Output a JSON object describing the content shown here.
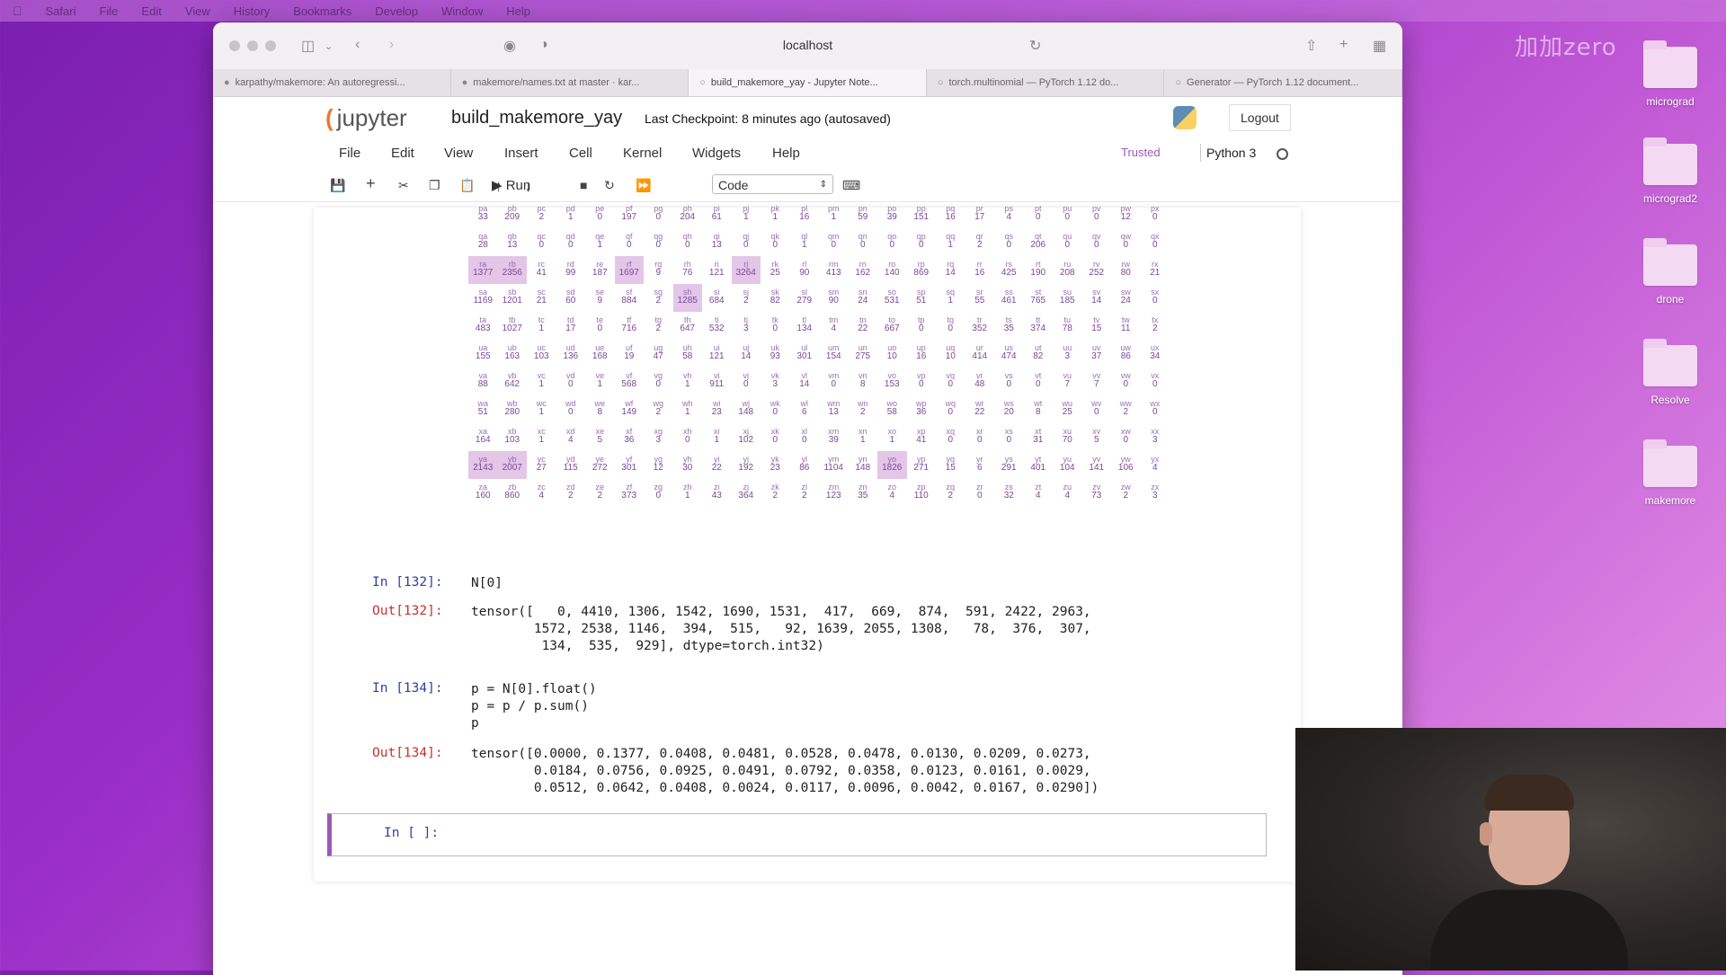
{
  "menubar": {
    "items": [
      "Safari",
      "File",
      "Edit",
      "View",
      "History",
      "Bookmarks",
      "Develop",
      "Window",
      "Help"
    ]
  },
  "watermark": "加加zero",
  "desktop": {
    "icons": [
      "micrograd",
      "micrograd2",
      "drone",
      "Resolve",
      "makemore"
    ]
  },
  "browser": {
    "url": "localhost",
    "tabs": [
      "karpathy/makemore: An autoregressi...",
      "makemore/names.txt at master · kar...",
      "build_makemore_yay - Jupyter Note...",
      "torch.multinomial — PyTorch 1.12 do...",
      "Generator — PyTorch 1.12 document..."
    ]
  },
  "jupyter": {
    "logo": "jupyter",
    "notebook_name": "build_makemore_yay",
    "checkpoint": "Last Checkpoint: 8 minutes ago  (autosaved)",
    "logout": "Logout",
    "menu": [
      "File",
      "Edit",
      "View",
      "Insert",
      "Cell",
      "Kernel",
      "Widgets",
      "Help"
    ],
    "trusted": "Trusted",
    "kernel": "Python 3",
    "toolbar": {
      "run_label": "Run",
      "cell_type": "Code"
    }
  },
  "bigram_grid": {
    "rows": [
      [
        [
          "pa",
          "33"
        ],
        [
          "pb",
          "209"
        ],
        [
          "pc",
          "2"
        ],
        [
          "pd",
          "1"
        ],
        [
          "pe",
          "0"
        ],
        [
          "pf",
          "197"
        ],
        [
          "pg",
          "0"
        ],
        [
          "ph",
          "204"
        ],
        [
          "pi",
          "61"
        ],
        [
          "pj",
          "1"
        ],
        [
          "pk",
          "1"
        ],
        [
          "pl",
          "16"
        ],
        [
          "pm",
          "1"
        ],
        [
          "pn",
          "59"
        ],
        [
          "po",
          "39"
        ],
        [
          "pp",
          "151"
        ],
        [
          "pq",
          "16"
        ],
        [
          "pr",
          "17"
        ],
        [
          "ps",
          "4"
        ],
        [
          "pt",
          "0"
        ],
        [
          "pu",
          "0"
        ],
        [
          "pv",
          "0"
        ],
        [
          "pw",
          "12"
        ],
        [
          "px",
          "0"
        ]
      ],
      [
        [
          "qa",
          "28"
        ],
        [
          "qb",
          "13"
        ],
        [
          "qc",
          "0"
        ],
        [
          "qd",
          "0"
        ],
        [
          "qe",
          "1"
        ],
        [
          "qf",
          "0"
        ],
        [
          "qg",
          "0"
        ],
        [
          "qh",
          "0"
        ],
        [
          "qi",
          "13"
        ],
        [
          "qj",
          "0"
        ],
        [
          "qk",
          "0"
        ],
        [
          "ql",
          "1"
        ],
        [
          "qm",
          "0"
        ],
        [
          "qn",
          "0"
        ],
        [
          "qo",
          "0"
        ],
        [
          "qp",
          "0"
        ],
        [
          "qq",
          "1"
        ],
        [
          "qr",
          "2"
        ],
        [
          "qs",
          "0"
        ],
        [
          "qt",
          "206"
        ],
        [
          "qu",
          "0"
        ],
        [
          "qv",
          "0"
        ],
        [
          "qw",
          "0"
        ],
        [
          "qx",
          "0"
        ]
      ],
      [
        [
          "ra",
          "1377"
        ],
        [
          "rb",
          "2356"
        ],
        [
          "rc",
          "41"
        ],
        [
          "rd",
          "99"
        ],
        [
          "re",
          "187"
        ],
        [
          "rf",
          "1697"
        ],
        [
          "rg",
          "9"
        ],
        [
          "rh",
          "76"
        ],
        [
          "ri",
          "121"
        ],
        [
          "rj",
          "3264"
        ],
        [
          "rk",
          "25"
        ],
        [
          "rl",
          "90"
        ],
        [
          "rm",
          "413"
        ],
        [
          "rn",
          "162"
        ],
        [
          "ro",
          "140"
        ],
        [
          "rp",
          "869"
        ],
        [
          "rq",
          "14"
        ],
        [
          "rr",
          "16"
        ],
        [
          "rs",
          "425"
        ],
        [
          "rt",
          "190"
        ],
        [
          "ru",
          "208"
        ],
        [
          "rv",
          "252"
        ],
        [
          "rw",
          "80"
        ],
        [
          "rx",
          "21"
        ]
      ],
      [
        [
          "sa",
          "1169"
        ],
        [
          "sb",
          "1201"
        ],
        [
          "sc",
          "21"
        ],
        [
          "sd",
          "60"
        ],
        [
          "se",
          "9"
        ],
        [
          "sf",
          "884"
        ],
        [
          "sg",
          "2"
        ],
        [
          "sh",
          "1285"
        ],
        [
          "si",
          "684"
        ],
        [
          "sj",
          "2"
        ],
        [
          "sk",
          "82"
        ],
        [
          "sl",
          "279"
        ],
        [
          "sm",
          "90"
        ],
        [
          "sn",
          "24"
        ],
        [
          "so",
          "531"
        ],
        [
          "sp",
          "51"
        ],
        [
          "sq",
          "1"
        ],
        [
          "sr",
          "55"
        ],
        [
          "ss",
          "461"
        ],
        [
          "st",
          "765"
        ],
        [
          "su",
          "185"
        ],
        [
          "sv",
          "14"
        ],
        [
          "sw",
          "24"
        ],
        [
          "sx",
          "0"
        ]
      ],
      [
        [
          "ta",
          "483"
        ],
        [
          "tb",
          "1027"
        ],
        [
          "tc",
          "1"
        ],
        [
          "td",
          "17"
        ],
        [
          "te",
          "0"
        ],
        [
          "tf",
          "716"
        ],
        [
          "tg",
          "2"
        ],
        [
          "th",
          "647"
        ],
        [
          "ti",
          "532"
        ],
        [
          "tj",
          "3"
        ],
        [
          "tk",
          "0"
        ],
        [
          "tl",
          "134"
        ],
        [
          "tm",
          "4"
        ],
        [
          "tn",
          "22"
        ],
        [
          "to",
          "667"
        ],
        [
          "tp",
          "0"
        ],
        [
          "tq",
          "0"
        ],
        [
          "tr",
          "352"
        ],
        [
          "ts",
          "35"
        ],
        [
          "tt",
          "374"
        ],
        [
          "tu",
          "78"
        ],
        [
          "tv",
          "15"
        ],
        [
          "tw",
          "11"
        ],
        [
          "tx",
          "2"
        ]
      ],
      [
        [
          "ua",
          "155"
        ],
        [
          "ub",
          "163"
        ],
        [
          "uc",
          "103"
        ],
        [
          "ud",
          "136"
        ],
        [
          "ue",
          "168"
        ],
        [
          "uf",
          "19"
        ],
        [
          "ug",
          "47"
        ],
        [
          "uh",
          "58"
        ],
        [
          "ui",
          "121"
        ],
        [
          "uj",
          "14"
        ],
        [
          "uk",
          "93"
        ],
        [
          "ul",
          "301"
        ],
        [
          "um",
          "154"
        ],
        [
          "un",
          "275"
        ],
        [
          "uo",
          "10"
        ],
        [
          "up",
          "16"
        ],
        [
          "uq",
          "10"
        ],
        [
          "ur",
          "414"
        ],
        [
          "us",
          "474"
        ],
        [
          "ut",
          "82"
        ],
        [
          "uu",
          "3"
        ],
        [
          "uv",
          "37"
        ],
        [
          "uw",
          "86"
        ],
        [
          "ux",
          "34"
        ]
      ],
      [
        [
          "va",
          "88"
        ],
        [
          "vb",
          "642"
        ],
        [
          "vc",
          "1"
        ],
        [
          "vd",
          "0"
        ],
        [
          "ve",
          "1"
        ],
        [
          "vf",
          "568"
        ],
        [
          "vg",
          "0"
        ],
        [
          "vh",
          "1"
        ],
        [
          "vi",
          "911"
        ],
        [
          "vj",
          "0"
        ],
        [
          "vk",
          "3"
        ],
        [
          "vl",
          "14"
        ],
        [
          "vm",
          "0"
        ],
        [
          "vn",
          "8"
        ],
        [
          "vo",
          "153"
        ],
        [
          "vp",
          "0"
        ],
        [
          "vq",
          "0"
        ],
        [
          "vr",
          "48"
        ],
        [
          "vs",
          "0"
        ],
        [
          "vt",
          "0"
        ],
        [
          "vu",
          "7"
        ],
        [
          "vv",
          "7"
        ],
        [
          "vw",
          "0"
        ],
        [
          "vx",
          "0"
        ]
      ],
      [
        [
          "wa",
          "51"
        ],
        [
          "wb",
          "280"
        ],
        [
          "wc",
          "1"
        ],
        [
          "wd",
          "0"
        ],
        [
          "we",
          "8"
        ],
        [
          "wf",
          "149"
        ],
        [
          "wg",
          "2"
        ],
        [
          "wh",
          "1"
        ],
        [
          "wi",
          "23"
        ],
        [
          "wj",
          "148"
        ],
        [
          "wk",
          "0"
        ],
        [
          "wl",
          "6"
        ],
        [
          "wm",
          "13"
        ],
        [
          "wn",
          "2"
        ],
        [
          "wo",
          "58"
        ],
        [
          "wp",
          "36"
        ],
        [
          "wq",
          "0"
        ],
        [
          "wr",
          "22"
        ],
        [
          "ws",
          "20"
        ],
        [
          "wt",
          "8"
        ],
        [
          "wu",
          "25"
        ],
        [
          "wv",
          "0"
        ],
        [
          "ww",
          "2"
        ],
        [
          "wx",
          "0"
        ]
      ],
      [
        [
          "xa",
          "164"
        ],
        [
          "xb",
          "103"
        ],
        [
          "xc",
          "1"
        ],
        [
          "xd",
          "4"
        ],
        [
          "xe",
          "5"
        ],
        [
          "xf",
          "36"
        ],
        [
          "xg",
          "3"
        ],
        [
          "xh",
          "0"
        ],
        [
          "xi",
          "1"
        ],
        [
          "xj",
          "102"
        ],
        [
          "xk",
          "0"
        ],
        [
          "xl",
          "0"
        ],
        [
          "xm",
          "39"
        ],
        [
          "xn",
          "1"
        ],
        [
          "xo",
          "1"
        ],
        [
          "xp",
          "41"
        ],
        [
          "xq",
          "0"
        ],
        [
          "xr",
          "0"
        ],
        [
          "xs",
          "0"
        ],
        [
          "xt",
          "31"
        ],
        [
          "xu",
          "70"
        ],
        [
          "xv",
          "5"
        ],
        [
          "xw",
          "0"
        ],
        [
          "xx",
          "3"
        ]
      ],
      [
        [
          "ya",
          "2143"
        ],
        [
          "yb",
          "2007"
        ],
        [
          "yc",
          "27"
        ],
        [
          "yd",
          "115"
        ],
        [
          "ye",
          "272"
        ],
        [
          "yf",
          "301"
        ],
        [
          "yg",
          "12"
        ],
        [
          "yh",
          "30"
        ],
        [
          "yi",
          "22"
        ],
        [
          "yj",
          "192"
        ],
        [
          "yk",
          "23"
        ],
        [
          "yl",
          "86"
        ],
        [
          "ym",
          "1104"
        ],
        [
          "yn",
          "148"
        ],
        [
          "yo",
          "1826"
        ],
        [
          "yp",
          "271"
        ],
        [
          "yq",
          "15"
        ],
        [
          "yr",
          "6"
        ],
        [
          "ys",
          "291"
        ],
        [
          "yt",
          "401"
        ],
        [
          "yu",
          "104"
        ],
        [
          "yv",
          "141"
        ],
        [
          "yw",
          "106"
        ],
        [
          "yx",
          "4"
        ]
      ],
      [
        [
          "za",
          "160"
        ],
        [
          "zb",
          "860"
        ],
        [
          "zc",
          "4"
        ],
        [
          "zd",
          "2"
        ],
        [
          "ze",
          "2"
        ],
        [
          "zf",
          "373"
        ],
        [
          "zg",
          "0"
        ],
        [
          "zh",
          "1"
        ],
        [
          "zi",
          "43"
        ],
        [
          "zj",
          "364"
        ],
        [
          "zk",
          "2"
        ],
        [
          "zl",
          "2"
        ],
        [
          "zm",
          "123"
        ],
        [
          "zn",
          "35"
        ],
        [
          "zo",
          "4"
        ],
        [
          "zp",
          "110"
        ],
        [
          "zq",
          "2"
        ],
        [
          "zr",
          "0"
        ],
        [
          "zs",
          "32"
        ],
        [
          "zt",
          "4"
        ],
        [
          "zu",
          "4"
        ],
        [
          "zv",
          "73"
        ],
        [
          "zw",
          "2"
        ],
        [
          "zx",
          "3"
        ]
      ]
    ],
    "highlighted": [
      "ra",
      "rb",
      "rf",
      "rj",
      "sh",
      "ya",
      "yb",
      "yo"
    ]
  },
  "cells": {
    "in132_prompt": "In [132]:",
    "in132_code": "N[0]",
    "out132_prompt": "Out[132]:",
    "out132_text": "tensor([   0, 4410, 1306, 1542, 1690, 1531,  417,  669,  874,  591, 2422, 2963,\n        1572, 2538, 1146,  394,  515,   92, 1639, 2055, 1308,   78,  376,  307,\n         134,  535,  929], dtype=torch.int32)",
    "in134_prompt": "In [134]:",
    "in134_line1": "p = N[0].float()",
    "in134_line2": "p = p / p.sum()",
    "in134_line3": "p",
    "out134_prompt": "Out[134]:",
    "out134_text": "tensor([0.0000, 0.1377, 0.0408, 0.0481, 0.0528, 0.0478, 0.0130, 0.0209, 0.0273,\n        0.0184, 0.0756, 0.0925, 0.0491, 0.0792, 0.0358, 0.0123, 0.0161, 0.0029,\n        0.0512, 0.0642, 0.0408, 0.0024, 0.0117, 0.0096, 0.0042, 0.0167, 0.0290])",
    "empty_prompt": "In [ ]:"
  }
}
